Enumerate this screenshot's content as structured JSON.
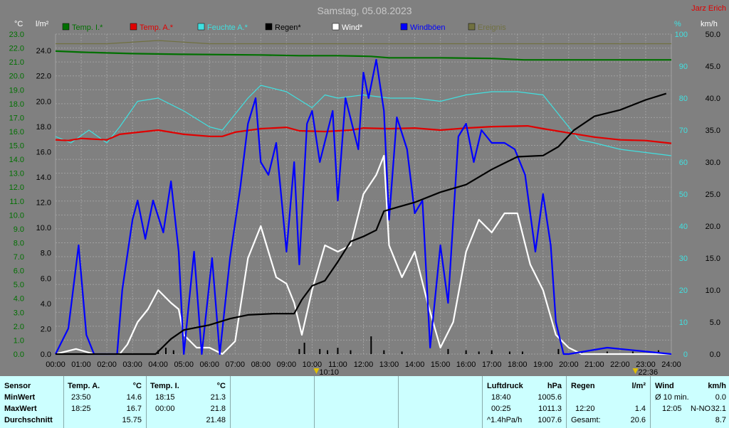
{
  "title": "Samstag, 05.08.2023",
  "author": "Jarz Erich",
  "colors": {
    "background": "#808080",
    "grid": "#a0a0a0",
    "temp_i": "#007000",
    "temp_a": "#e00000",
    "humidity": "#40e0e0",
    "rain": "#000000",
    "wind": "#ffffff",
    "gusts": "#0000ff",
    "pressure": "#707040",
    "table_bg": "#ccffff"
  },
  "chart_data": {
    "type": "line",
    "title": "Samstag, 05.08.2023",
    "x_ticks": [
      "00:00",
      "01:00",
      "02:00",
      "03:00",
      "04:00",
      "05:00",
      "06:00",
      "07:00",
      "08:00",
      "09:00",
      "10:00",
      "11:00",
      "12:00",
      "13:00",
      "14:00",
      "15:00",
      "16:00",
      "17:00",
      "18:00",
      "19:00",
      "20:00",
      "21:00",
      "22:00",
      "23:00",
      "24:00"
    ],
    "x_range_hours": [
      0,
      24
    ],
    "left_axis_c": {
      "label": "°C",
      "ticks": [
        "23.0",
        "22.0",
        "21.0",
        "20.0",
        "19.0",
        "18.0",
        "17.0",
        "16.0",
        "15.0",
        "14.0",
        "13.0",
        "12.0",
        "11.0",
        "10.0",
        "9.0",
        "8.0",
        "7.0",
        "6.0",
        "5.0",
        "4.0",
        "3.0",
        "2.0",
        "1.0",
        "0.0"
      ],
      "range": [
        0,
        23
      ]
    },
    "left_axis_rain": {
      "label": "l/m²",
      "ticks": [
        "24.0",
        "22.0",
        "20.0",
        "18.0",
        "16.0",
        "14.0",
        "12.0",
        "10.0",
        "8.0",
        "6.0",
        "4.0",
        "2.0",
        "0.0"
      ],
      "range": [
        0,
        25.3
      ]
    },
    "right_axis_pct": {
      "label": "%",
      "ticks": [
        "100",
        "90",
        "80",
        "70",
        "60",
        "50",
        "40",
        "30",
        "20",
        "10",
        "0"
      ],
      "range": [
        0,
        100
      ]
    },
    "right_axis_kmh": {
      "label": "km/h",
      "ticks": [
        "50.0",
        "45.0",
        "40.0",
        "35.0",
        "30.0",
        "25.0",
        "20.0",
        "15.0",
        "10.0",
        "5.0",
        "0.0"
      ],
      "range": [
        0,
        50
      ]
    },
    "legend": [
      "Temp. I.*",
      "Temp. A.*",
      "Feuchte A.*",
      "Regen*",
      "Wind*",
      "Windböen",
      "Ereignis"
    ],
    "series": [
      {
        "name": "Temp. I.*",
        "axis": "c",
        "points": [
          [
            0,
            21.78
          ],
          [
            1,
            21.7
          ],
          [
            3,
            21.6
          ],
          [
            5,
            21.55
          ],
          [
            8,
            21.5
          ],
          [
            9.5,
            21.45
          ],
          [
            11,
            21.45
          ],
          [
            12.3,
            21.4
          ],
          [
            13,
            21.3
          ],
          [
            15,
            21.3
          ],
          [
            17,
            21.25
          ],
          [
            18.25,
            21.15
          ],
          [
            24,
            21.15
          ]
        ]
      },
      {
        "name": "Temp. A.*",
        "axis": "c",
        "points": [
          [
            0,
            15.4
          ],
          [
            0.5,
            15.35
          ],
          [
            1,
            15.5
          ],
          [
            2,
            15.4
          ],
          [
            2.5,
            15.8
          ],
          [
            3,
            15.9
          ],
          [
            4,
            16.1
          ],
          [
            5,
            15.8
          ],
          [
            6,
            15.65
          ],
          [
            6.5,
            15.65
          ],
          [
            7,
            15.95
          ],
          [
            8,
            16.2
          ],
          [
            9,
            16.3
          ],
          [
            9.5,
            16.05
          ],
          [
            10.5,
            16.0
          ],
          [
            11.5,
            16.1
          ],
          [
            12,
            16.25
          ],
          [
            13,
            16.2
          ],
          [
            14,
            16.25
          ],
          [
            15,
            16.1
          ],
          [
            16,
            16.25
          ],
          [
            17,
            16.35
          ],
          [
            18.4,
            16.4
          ],
          [
            19,
            16.2
          ],
          [
            20,
            15.9
          ],
          [
            21,
            15.6
          ],
          [
            22,
            15.4
          ],
          [
            23,
            15.35
          ],
          [
            24,
            15.15
          ]
        ]
      },
      {
        "name": "Feuchte A.*",
        "axis": "pct",
        "points": [
          [
            0,
            68
          ],
          [
            0.6,
            66
          ],
          [
            1.3,
            70
          ],
          [
            2,
            66
          ],
          [
            2.5,
            71
          ],
          [
            3.2,
            79
          ],
          [
            4,
            80
          ],
          [
            5,
            76
          ],
          [
            6,
            71
          ],
          [
            6.5,
            70
          ],
          [
            7.5,
            80
          ],
          [
            8,
            84
          ],
          [
            9,
            82
          ],
          [
            10,
            77
          ],
          [
            10.5,
            81
          ],
          [
            11,
            80
          ],
          [
            12,
            81
          ],
          [
            13,
            80
          ],
          [
            14,
            80
          ],
          [
            15,
            79
          ],
          [
            16,
            81
          ],
          [
            17,
            82
          ],
          [
            18,
            82
          ],
          [
            19,
            81
          ],
          [
            19.7,
            74
          ],
          [
            20.4,
            67
          ],
          [
            21,
            66
          ],
          [
            22,
            64
          ],
          [
            23,
            63
          ],
          [
            24,
            62
          ]
        ]
      },
      {
        "name": "Regen*",
        "axis": "rain",
        "points": [
          [
            0,
            0
          ],
          [
            3.9,
            0
          ],
          [
            4.5,
            1.2
          ],
          [
            5,
            1.9
          ],
          [
            6,
            2.3
          ],
          [
            6.8,
            2.8
          ],
          [
            7.5,
            3.1
          ],
          [
            8.5,
            3.2
          ],
          [
            9.3,
            3.2
          ],
          [
            9.6,
            4.3
          ],
          [
            10,
            5.4
          ],
          [
            10.5,
            5.8
          ],
          [
            11,
            7.3
          ],
          [
            11.5,
            8.9
          ],
          [
            12,
            9.3
          ],
          [
            12.5,
            9.8
          ],
          [
            12.8,
            11.3
          ],
          [
            13.3,
            11.6
          ],
          [
            14,
            12.0
          ],
          [
            15,
            12.8
          ],
          [
            16,
            13.4
          ],
          [
            17,
            14.6
          ],
          [
            17.5,
            15.1
          ],
          [
            18,
            15.6
          ],
          [
            19,
            15.7
          ],
          [
            19.6,
            16.4
          ],
          [
            20.2,
            17.7
          ],
          [
            21,
            18.8
          ],
          [
            22,
            19.3
          ],
          [
            22.5,
            19.7
          ],
          [
            23,
            20.1
          ],
          [
            23.8,
            20.6
          ]
        ]
      },
      {
        "name": "Wind*",
        "axis": "kmh",
        "points": [
          [
            0,
            0
          ],
          [
            0.8,
            0.8
          ],
          [
            1.5,
            0
          ],
          [
            2.5,
            0
          ],
          [
            2.8,
            1.5
          ],
          [
            3.2,
            5
          ],
          [
            3.6,
            7
          ],
          [
            4,
            10
          ],
          [
            4.5,
            8
          ],
          [
            4.8,
            7
          ],
          [
            5,
            3
          ],
          [
            5.5,
            1
          ],
          [
            6,
            1
          ],
          [
            6.5,
            0
          ],
          [
            7,
            2
          ],
          [
            7.5,
            15
          ],
          [
            8,
            20
          ],
          [
            8.3,
            16
          ],
          [
            8.6,
            12
          ],
          [
            9,
            11
          ],
          [
            9.3,
            8
          ],
          [
            9.6,
            3
          ],
          [
            10,
            10
          ],
          [
            10.5,
            17
          ],
          [
            11,
            16
          ],
          [
            11.5,
            17
          ],
          [
            12,
            25
          ],
          [
            12.5,
            28
          ],
          [
            12.8,
            31
          ],
          [
            13,
            17
          ],
          [
            13.5,
            12
          ],
          [
            14,
            16
          ],
          [
            14.5,
            8
          ],
          [
            15,
            1
          ],
          [
            15.5,
            5
          ],
          [
            16,
            16
          ],
          [
            16.5,
            21
          ],
          [
            17,
            19
          ],
          [
            17.5,
            22
          ],
          [
            18,
            22
          ],
          [
            18.5,
            14
          ],
          [
            19,
            10
          ],
          [
            19.5,
            3
          ],
          [
            20,
            1
          ],
          [
            20.5,
            0
          ],
          [
            24,
            0
          ]
        ]
      },
      {
        "name": "Windböen",
        "axis": "kmh",
        "points": [
          [
            0,
            0
          ],
          [
            0.5,
            4
          ],
          [
            0.9,
            17
          ],
          [
            1.2,
            3
          ],
          [
            1.5,
            0
          ],
          [
            2.4,
            0
          ],
          [
            2.6,
            10
          ],
          [
            3,
            21
          ],
          [
            3.2,
            24
          ],
          [
            3.5,
            18
          ],
          [
            3.8,
            24
          ],
          [
            4.2,
            19
          ],
          [
            4.5,
            27
          ],
          [
            4.8,
            16
          ],
          [
            5,
            0
          ],
          [
            5.4,
            16
          ],
          [
            5.7,
            0
          ],
          [
            6.1,
            15
          ],
          [
            6.4,
            0
          ],
          [
            6.8,
            15
          ],
          [
            7.2,
            26
          ],
          [
            7.5,
            36
          ],
          [
            7.8,
            40
          ],
          [
            8,
            30
          ],
          [
            8.3,
            28
          ],
          [
            8.6,
            33
          ],
          [
            9,
            16
          ],
          [
            9.3,
            30
          ],
          [
            9.5,
            14
          ],
          [
            9.8,
            36
          ],
          [
            10,
            38
          ],
          [
            10.3,
            30
          ],
          [
            10.8,
            38
          ],
          [
            11,
            24
          ],
          [
            11.3,
            40
          ],
          [
            11.8,
            32
          ],
          [
            12,
            44
          ],
          [
            12.2,
            40
          ],
          [
            12.5,
            46
          ],
          [
            12.8,
            38
          ],
          [
            13,
            21
          ],
          [
            13.3,
            37
          ],
          [
            13.7,
            32
          ],
          [
            14,
            22
          ],
          [
            14.3,
            24
          ],
          [
            14.6,
            1
          ],
          [
            15,
            17
          ],
          [
            15.3,
            8
          ],
          [
            15.7,
            34
          ],
          [
            16,
            36
          ],
          [
            16.3,
            30
          ],
          [
            16.6,
            35
          ],
          [
            17,
            33
          ],
          [
            17.5,
            33
          ],
          [
            17.9,
            32
          ],
          [
            18.3,
            28
          ],
          [
            18.7,
            16
          ],
          [
            19,
            25
          ],
          [
            19.3,
            17
          ],
          [
            19.5,
            5
          ],
          [
            19.8,
            0
          ],
          [
            20,
            0
          ],
          [
            21.5,
            1
          ],
          [
            24,
            0
          ]
        ]
      },
      {
        "name": "Ereignis",
        "axis": "pct",
        "points": [
          [
            0,
            97
          ],
          [
            2,
            97
          ],
          [
            4,
            98
          ],
          [
            6,
            97
          ],
          [
            8,
            97
          ],
          [
            10,
            97
          ],
          [
            12,
            97
          ],
          [
            14,
            97
          ],
          [
            16,
            97
          ],
          [
            18,
            97
          ],
          [
            20,
            97
          ],
          [
            22,
            97
          ],
          [
            24,
            97
          ]
        ]
      }
    ],
    "rain_bars_mm": [
      [
        4.0,
        0.3
      ],
      [
        4.3,
        0.5
      ],
      [
        4.6,
        0.3
      ],
      [
        5.0,
        0.2
      ],
      [
        9.5,
        0.4
      ],
      [
        9.7,
        0.9
      ],
      [
        10.3,
        0.4
      ],
      [
        10.6,
        0.3
      ],
      [
        11.0,
        0.5
      ],
      [
        11.5,
        0.3
      ],
      [
        12.3,
        1.4
      ],
      [
        12.8,
        0.3
      ],
      [
        13.5,
        0.2
      ],
      [
        15.3,
        0.4
      ],
      [
        16.0,
        0.3
      ],
      [
        16.5,
        0.2
      ],
      [
        17.0,
        0.3
      ],
      [
        17.7,
        0.2
      ],
      [
        18.2,
        0.2
      ],
      [
        19.6,
        0.4
      ],
      [
        20.5,
        0.2
      ],
      [
        21.5,
        0.2
      ],
      [
        22.5,
        0.2
      ],
      [
        23.5,
        0.3
      ]
    ]
  },
  "markers": [
    {
      "time": "10:10",
      "label": "10:10",
      "color": "#e0c000"
    },
    {
      "time": "22:36",
      "label": "22:36",
      "color": "#e0c000"
    }
  ],
  "table": {
    "sensor": {
      "header": "Sensor",
      "rows": [
        "MinWert",
        "MaxWert",
        "Durchschnitt"
      ]
    },
    "temp_a": {
      "header": "Temp. A.",
      "unit": "°C",
      "times": [
        "23:50",
        "18:25",
        ""
      ],
      "values": [
        "14.6",
        "16.7",
        "15.75"
      ]
    },
    "temp_i": {
      "header": "Temp. I.",
      "unit": "°C",
      "times": [
        "18:15",
        "00:00",
        ""
      ],
      "values": [
        "21.3",
        "21.8",
        "21.48"
      ]
    },
    "pressure": {
      "header": "Luftdruck",
      "unit": "hPa",
      "times": [
        "18:40",
        "00:25",
        "^1.4hPa/h"
      ],
      "values": [
        "1005.6",
        "1011.3",
        "1007.6"
      ]
    },
    "rain": {
      "header": "Regen",
      "unit": "l/m²",
      "times": [
        "",
        "12:20",
        "Gesamt:"
      ],
      "values": [
        "",
        "1.4",
        "20.6"
      ]
    },
    "wind": {
      "header": "Wind",
      "unit": "km/h",
      "times": [
        "Ø 10 min.",
        "12:05",
        ""
      ],
      "dirs": [
        "",
        "N-NO",
        ""
      ],
      "values": [
        "0.0",
        "32.1",
        "8.7"
      ]
    }
  }
}
